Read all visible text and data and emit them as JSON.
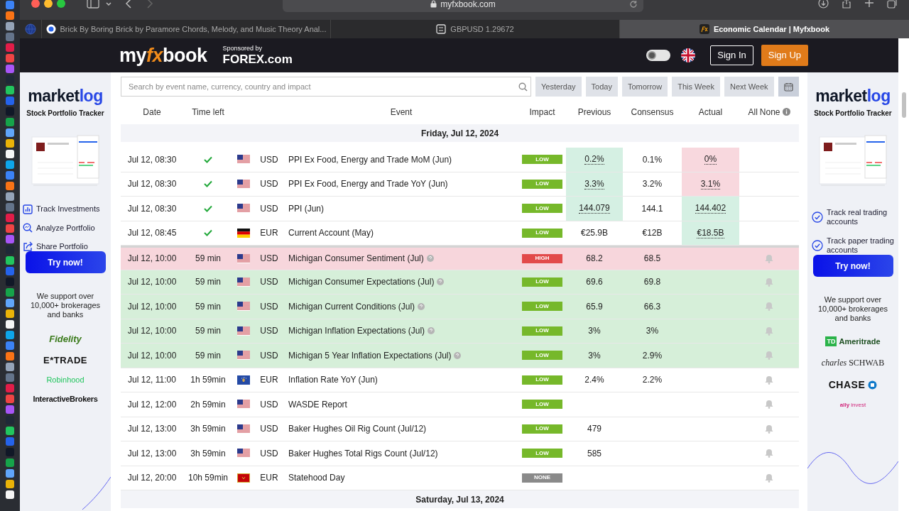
{
  "browser": {
    "address": "myfxbook.com",
    "tabs": [
      {
        "title": "Brick By Boring Brick by Paramore Chords, Melody, and Music Theory Anal...",
        "selected": false
      },
      {
        "title": "GBPUSD 1.29672",
        "selected": false
      },
      {
        "title": "Economic Calendar | Myfxbook",
        "selected": true
      }
    ]
  },
  "header": {
    "logo": [
      "my",
      "fx",
      "book"
    ],
    "sponsor_label": "Sponsored by",
    "sponsor": "FOREX.com",
    "dark_mode": false,
    "sign_in": "Sign In",
    "sign_up": "Sign Up"
  },
  "left_ad": {
    "logo": [
      "market",
      "log"
    ],
    "tagline": "Stock Portfolio Tracker",
    "features": [
      {
        "kind": "chart",
        "text": "Track Investments"
      },
      {
        "kind": "analyze",
        "text": "Analyze Portfolio"
      },
      {
        "kind": "share",
        "text": "Share Portfolio"
      }
    ],
    "button": "Try now!",
    "support": "We support over 10,000+ brokerages and banks",
    "brokers": [
      {
        "kind": "fidelity",
        "name": "Fidelity"
      },
      {
        "kind": "etrade",
        "name": "E*TRADE"
      },
      {
        "kind": "robinhood",
        "name": "Robinhood"
      },
      {
        "kind": "ib",
        "name": "InteractiveBrokers"
      }
    ]
  },
  "calendar": {
    "search": {
      "placeholder": "Search by event name, currency, country and impact"
    },
    "periods": [
      {
        "label": "Yesterday",
        "selected": false
      },
      {
        "label": "Today",
        "selected": false
      },
      {
        "label": "Tomorrow",
        "selected": false
      },
      {
        "label": "This Week",
        "selected": false
      },
      {
        "label": "Next Week",
        "selected": false
      }
    ],
    "columns": [
      "Date",
      "Time left",
      "Event",
      "Impact",
      "Previous",
      "Consensus",
      "Actual"
    ],
    "select_links": [
      "All",
      "None"
    ],
    "days": [
      {
        "date": "Friday, Jul 12, 2024",
        "rows": [
          {
            "date": "Jul 12, 08:30",
            "released": true,
            "flag": {
              "kind": "us"
            },
            "currency": "USD",
            "event": "PPI Ex Food, Energy and Trade MoM (Jun)",
            "info": false,
            "impact": "LOW",
            "previous": "0.2%",
            "previous_better": true,
            "consensus": "0.1%",
            "actual": "0%",
            "actual_better": false,
            "bell": false,
            "highlighted": false
          },
          {
            "date": "Jul 12, 08:30",
            "released": true,
            "flag": {
              "kind": "us"
            },
            "currency": "USD",
            "event": "PPI Ex Food, Energy and Trade YoY (Jun)",
            "info": false,
            "impact": "LOW",
            "previous": "3.3%",
            "previous_better": true,
            "consensus": "3.2%",
            "actual": "3.1%",
            "actual_better": false,
            "bell": false,
            "highlighted": false
          },
          {
            "date": "Jul 12, 08:30",
            "released": true,
            "flag": {
              "kind": "us"
            },
            "currency": "USD",
            "event": "PPI (Jun)",
            "info": false,
            "impact": "LOW",
            "previous": "144.079",
            "previous_better": true,
            "consensus": "144.1",
            "actual": "144.402",
            "actual_better": true,
            "bell": false,
            "highlighted": false
          },
          {
            "date": "Jul 12, 08:45",
            "released": true,
            "flag": {
              "kind": "de"
            },
            "currency": "EUR",
            "event": "Current Account (May)",
            "info": false,
            "impact": "LOW",
            "previous": "€25.9B",
            "previous_better": false,
            "consensus": "€12B",
            "actual": "€18.5B",
            "actual_better": true,
            "bell": false,
            "highlighted": false
          },
          {
            "date": "Jul 12, 10:00",
            "released": false,
            "time_left": "59 min",
            "flag": {
              "kind": "us"
            },
            "currency": "USD",
            "event": "Michigan Consumer Sentiment (Jul)",
            "info": true,
            "impact": "HIGH",
            "previous": "68.2",
            "previous_better": false,
            "consensus": "68.5",
            "bell": true,
            "highlighted": true
          },
          {
            "date": "Jul 12, 10:00",
            "released": false,
            "time_left": "59 min",
            "flag": {
              "kind": "us"
            },
            "currency": "USD",
            "event": "Michigan Consumer Expectations (Jul)",
            "info": true,
            "impact": "LOW",
            "previous": "69.6",
            "previous_better": false,
            "consensus": "69.8",
            "bell": true,
            "highlighted": true
          },
          {
            "date": "Jul 12, 10:00",
            "released": false,
            "time_left": "59 min",
            "flag": {
              "kind": "us"
            },
            "currency": "USD",
            "event": "Michigan Current Conditions (Jul)",
            "info": true,
            "impact": "LOW",
            "previous": "65.9",
            "previous_better": false,
            "consensus": "66.3",
            "bell": true,
            "highlighted": true
          },
          {
            "date": "Jul 12, 10:00",
            "released": false,
            "time_left": "59 min",
            "flag": {
              "kind": "us"
            },
            "currency": "USD",
            "event": "Michigan Inflation Expectations (Jul)",
            "info": true,
            "impact": "LOW",
            "previous": "3%",
            "previous_better": false,
            "consensus": "3%",
            "bell": true,
            "highlighted": true
          },
          {
            "date": "Jul 12, 10:00",
            "released": false,
            "time_left": "59 min",
            "flag": {
              "kind": "us"
            },
            "currency": "USD",
            "event": "Michigan 5 Year Inflation Expectations (Jul)",
            "info": true,
            "impact": "LOW",
            "previous": "3%",
            "previous_better": false,
            "consensus": "2.9%",
            "bell": true,
            "highlighted": true
          },
          {
            "date": "Jul 12, 11:00",
            "released": false,
            "time_left": "1h 59min",
            "flag": {
              "kind": "xk"
            },
            "currency": "EUR",
            "event": "Inflation Rate YoY (Jun)",
            "info": false,
            "impact": "LOW",
            "previous": "2.4%",
            "previous_better": false,
            "consensus": "2.2%",
            "bell": true,
            "highlighted": false
          },
          {
            "date": "Jul 12, 12:00",
            "released": false,
            "time_left": "2h 59min",
            "flag": {
              "kind": "us"
            },
            "currency": "USD",
            "event": "WASDE Report",
            "info": false,
            "impact": "LOW",
            "bell": true,
            "highlighted": false
          },
          {
            "date": "Jul 12, 13:00",
            "released": false,
            "time_left": "3h 59min",
            "flag": {
              "kind": "us"
            },
            "currency": "USD",
            "event": "Baker Hughes Oil Rig Count (Jul/12)",
            "info": false,
            "impact": "LOW",
            "previous": "479",
            "previous_better": false,
            "bell": true,
            "highlighted": false
          },
          {
            "date": "Jul 12, 13:00",
            "released": false,
            "time_left": "3h 59min",
            "flag": {
              "kind": "us"
            },
            "currency": "USD",
            "event": "Baker Hughes Total Rigs Count (Jul/12)",
            "info": false,
            "impact": "LOW",
            "previous": "585",
            "previous_better": false,
            "bell": true,
            "highlighted": false
          },
          {
            "date": "Jul 12, 20:00",
            "released": false,
            "time_left": "10h 59min",
            "flag": {
              "kind": "me"
            },
            "currency": "EUR",
            "event": "Statehood Day",
            "info": false,
            "impact": "NONE",
            "bell": true,
            "highlighted": false
          }
        ]
      },
      {
        "date": "Saturday, Jul 13, 2024"
      }
    ]
  },
  "right_ad": {
    "logo": [
      "market",
      "log"
    ],
    "tagline": "Stock Portfolio Tracker",
    "features": [
      {
        "kind": "check",
        "text": "Track real trading accounts"
      },
      {
        "kind": "check",
        "text": "Track paper trading accounts"
      }
    ],
    "button": "Try now!",
    "support": "We support over 10,000+ brokerages and banks",
    "brokers": [
      {
        "kind": "td",
        "mark": "TD",
        "name": "Ameritrade"
      },
      {
        "kind": "schwab",
        "name": "*charles* SCHWAB"
      },
      {
        "kind": "chase",
        "name": "CHASE"
      },
      {
        "kind": "ally",
        "name": "**ally** invest"
      }
    ]
  }
}
